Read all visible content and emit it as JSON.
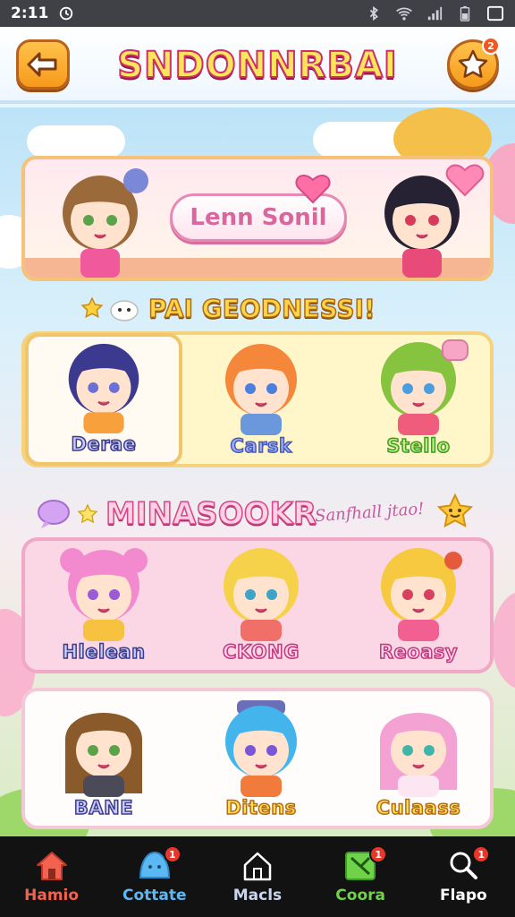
{
  "status_bar": {
    "time": "2:11",
    "icons": [
      "alarm-icon",
      "bluetooth-icon",
      "wifi-icon",
      "signal-icon",
      "battery-icon",
      "square-icon"
    ]
  },
  "header": {
    "title": "SNDONNRBAI",
    "back_icon": "arrow-left-icon",
    "fav_icon": "star-icon",
    "fav_badge": "2"
  },
  "banner": {
    "button_label": "Lenn Sonil"
  },
  "section1": {
    "title": "PAI GEODNESSI!",
    "characters": [
      {
        "name": "Derae",
        "hair": "#3b3a8f",
        "shirt": "#f7a03c",
        "selected": true,
        "name_style": "name-navy"
      },
      {
        "name": "Carsk",
        "hair": "#f5873b",
        "shirt": "#6b98dd",
        "selected": false,
        "name_style": "name-blue"
      },
      {
        "name": "Stello",
        "hair": "#86c43f",
        "shirt": "#f05d7c",
        "selected": false,
        "name_style": "name-green"
      }
    ]
  },
  "section2": {
    "title": "MINASOOKR",
    "tagline": "Sanfhall jtao!",
    "characters": [
      {
        "name": "Hlelean",
        "hair": "#f38ad0",
        "shirt": "#f6c23f",
        "name_style": "name-navy"
      },
      {
        "name": "CKONG",
        "hair": "#f6d24a",
        "shirt": "#f07069",
        "name_style": "name-pink"
      },
      {
        "name": "Reoasy",
        "hair": "#f7c940",
        "shirt": "#f16090",
        "name_style": "name-pink"
      }
    ]
  },
  "section3": {
    "characters": [
      {
        "name": "BANE",
        "hair": "#8b5a2b",
        "shirt": "#4a4a58",
        "name_style": "name-navy"
      },
      {
        "name": "Ditens",
        "hair": "#43b5ec",
        "shirt": "#f07b3a",
        "name_style": "name-gold"
      },
      {
        "name": "Culaass",
        "hair": "#f4a2d4",
        "shirt": "#fbe6f2",
        "name_style": "name-gold"
      }
    ]
  },
  "bottom_nav": [
    {
      "label": "Hamio",
      "icon": "home-icon",
      "color": "#f2624f",
      "badge": ""
    },
    {
      "label": "Cottate",
      "icon": "slime-icon",
      "color": "#5cb8f2",
      "badge": "1"
    },
    {
      "label": "Macls",
      "icon": "house-outline-icon",
      "color": "#c9d6ef",
      "badge": ""
    },
    {
      "label": "Coora",
      "icon": "map-icon",
      "color": "#6fd34a",
      "badge": "1"
    },
    {
      "label": "Flapo",
      "icon": "search-icon",
      "color": "#ffffff",
      "badge": "1"
    }
  ]
}
